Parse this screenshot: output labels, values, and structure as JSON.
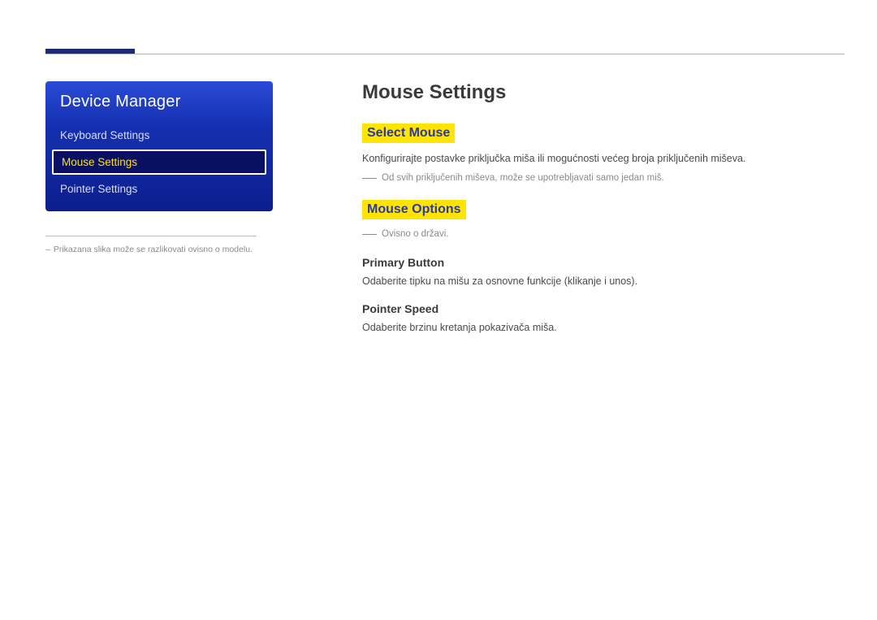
{
  "sidebar": {
    "title": "Device Manager",
    "items": [
      {
        "label": "Keyboard Settings",
        "selected": false
      },
      {
        "label": "Mouse Settings",
        "selected": true
      },
      {
        "label": "Pointer Settings",
        "selected": false
      }
    ],
    "note": "Prikazana slika može se razlikovati ovisno o modelu."
  },
  "main": {
    "title": "Mouse Settings",
    "select_mouse": {
      "heading": "Select Mouse",
      "desc": "Konfigurirajte postavke priključka miša ili mogućnosti većeg broja priključenih miševa.",
      "note": "Od svih priključenih miševa, može se upotrebljavati samo jedan miš."
    },
    "mouse_options": {
      "heading": "Mouse Options",
      "note": "Ovisno o državi.",
      "primary_button": {
        "heading": "Primary Button",
        "desc": "Odaberite tipku na mišu za osnovne funkcije (klikanje i unos)."
      },
      "pointer_speed": {
        "heading": "Pointer Speed",
        "desc": "Odaberite brzinu kretanja pokazivača miša."
      }
    }
  }
}
